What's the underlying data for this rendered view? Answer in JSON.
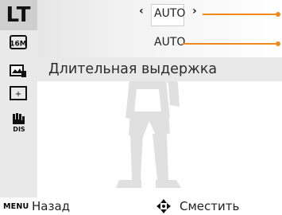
{
  "sidebar": {
    "mode_label": "LT",
    "icons": [
      "resolution-16m-icon",
      "quality-icon",
      "exposure-icon",
      "image-stabilizer-icon"
    ]
  },
  "topbar": {
    "setting_one": {
      "value": "AUTO",
      "left_arrow": "‹",
      "right_arrow": "›"
    },
    "setting_two": {
      "value": "AUTO"
    }
  },
  "mode_bar": {
    "title": "Длительная выдержка"
  },
  "bottombar": {
    "menu_key": "MENU",
    "back_label": "Назад",
    "move_label": "Сместить"
  },
  "colors": {
    "accent": "#f08a1c",
    "panel": "#e9e9e9"
  }
}
